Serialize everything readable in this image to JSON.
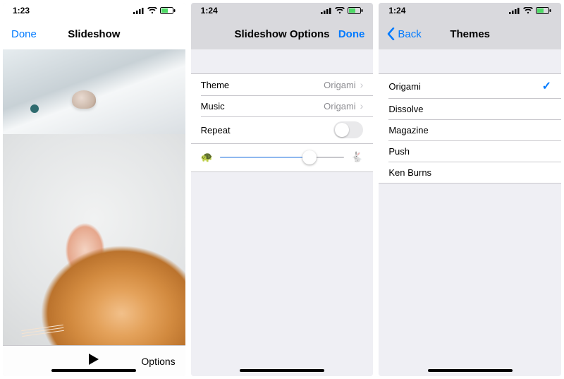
{
  "screen1": {
    "time": "1:23",
    "done": "Done",
    "title": "Slideshow",
    "options": "Options"
  },
  "screen2": {
    "time": "1:24",
    "title": "Slideshow Options",
    "done": "Done",
    "rows": {
      "theme_label": "Theme",
      "theme_value": "Origami",
      "music_label": "Music",
      "music_value": "Origami",
      "repeat_label": "Repeat"
    }
  },
  "screen3": {
    "time": "1:24",
    "back": "Back",
    "title": "Themes",
    "items": {
      "0": "Origami",
      "1": "Dissolve",
      "2": "Magazine",
      "3": "Push",
      "4": "Ken Burns"
    }
  }
}
